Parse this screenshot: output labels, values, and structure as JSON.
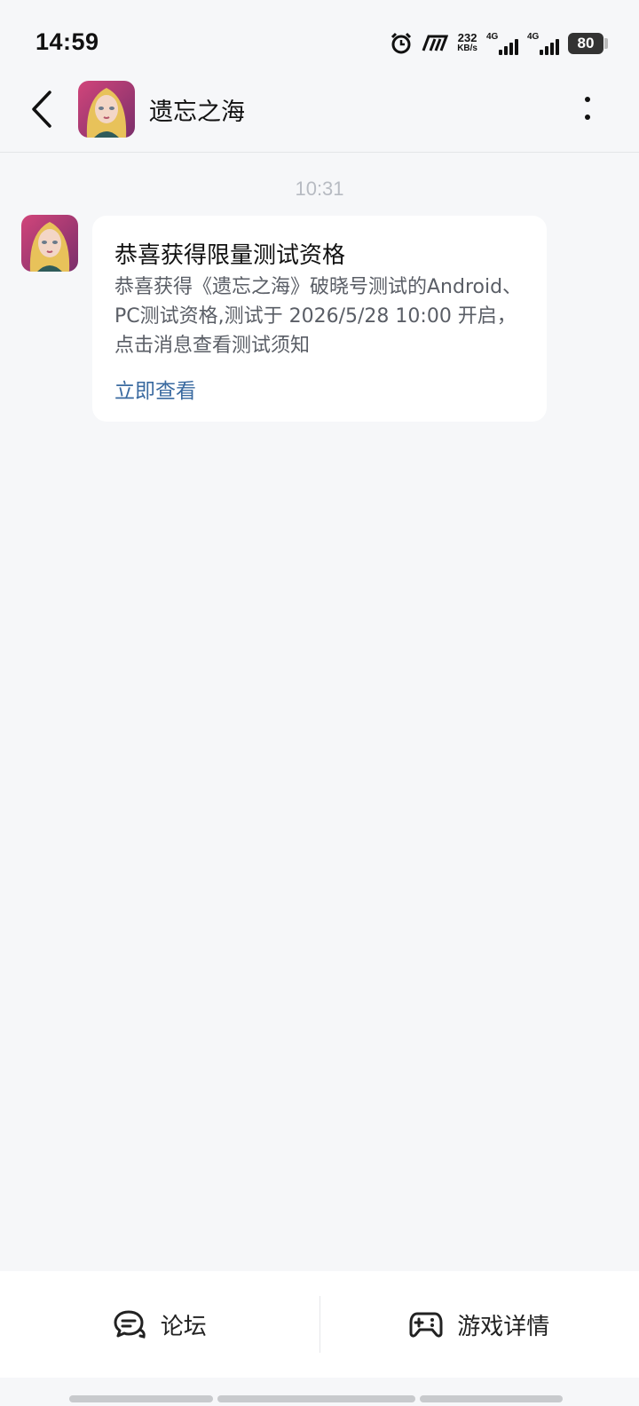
{
  "status_bar": {
    "time": "14:59",
    "speed_value": "232",
    "speed_unit": "KB/s",
    "sim1": "4G",
    "sim2": "4G",
    "battery": "80",
    "icons": [
      "alarm-icon",
      "app-m-icon",
      "signal-icon",
      "battery-icon"
    ]
  },
  "header": {
    "back_icon": "chevron-left-icon",
    "title": "遗忘之海",
    "more_icon": "more-vertical-icon"
  },
  "chat": {
    "timestamp": "10:31",
    "message": {
      "title": "恭喜获得限量测试资格",
      "body": "恭喜获得《遗忘之海》破晓号测试的Android、PC测试资格,测试于 2026/5/28 10:00 开启，点击消息查看测试须知",
      "link": "立即查看"
    }
  },
  "bottom_bar": {
    "forum_label": "论坛",
    "game_label": "游戏详情"
  },
  "colors": {
    "background": "#f6f7f9",
    "bubble": "#ffffff",
    "link": "#3a6aa0",
    "muted": "#b7bbc2"
  }
}
